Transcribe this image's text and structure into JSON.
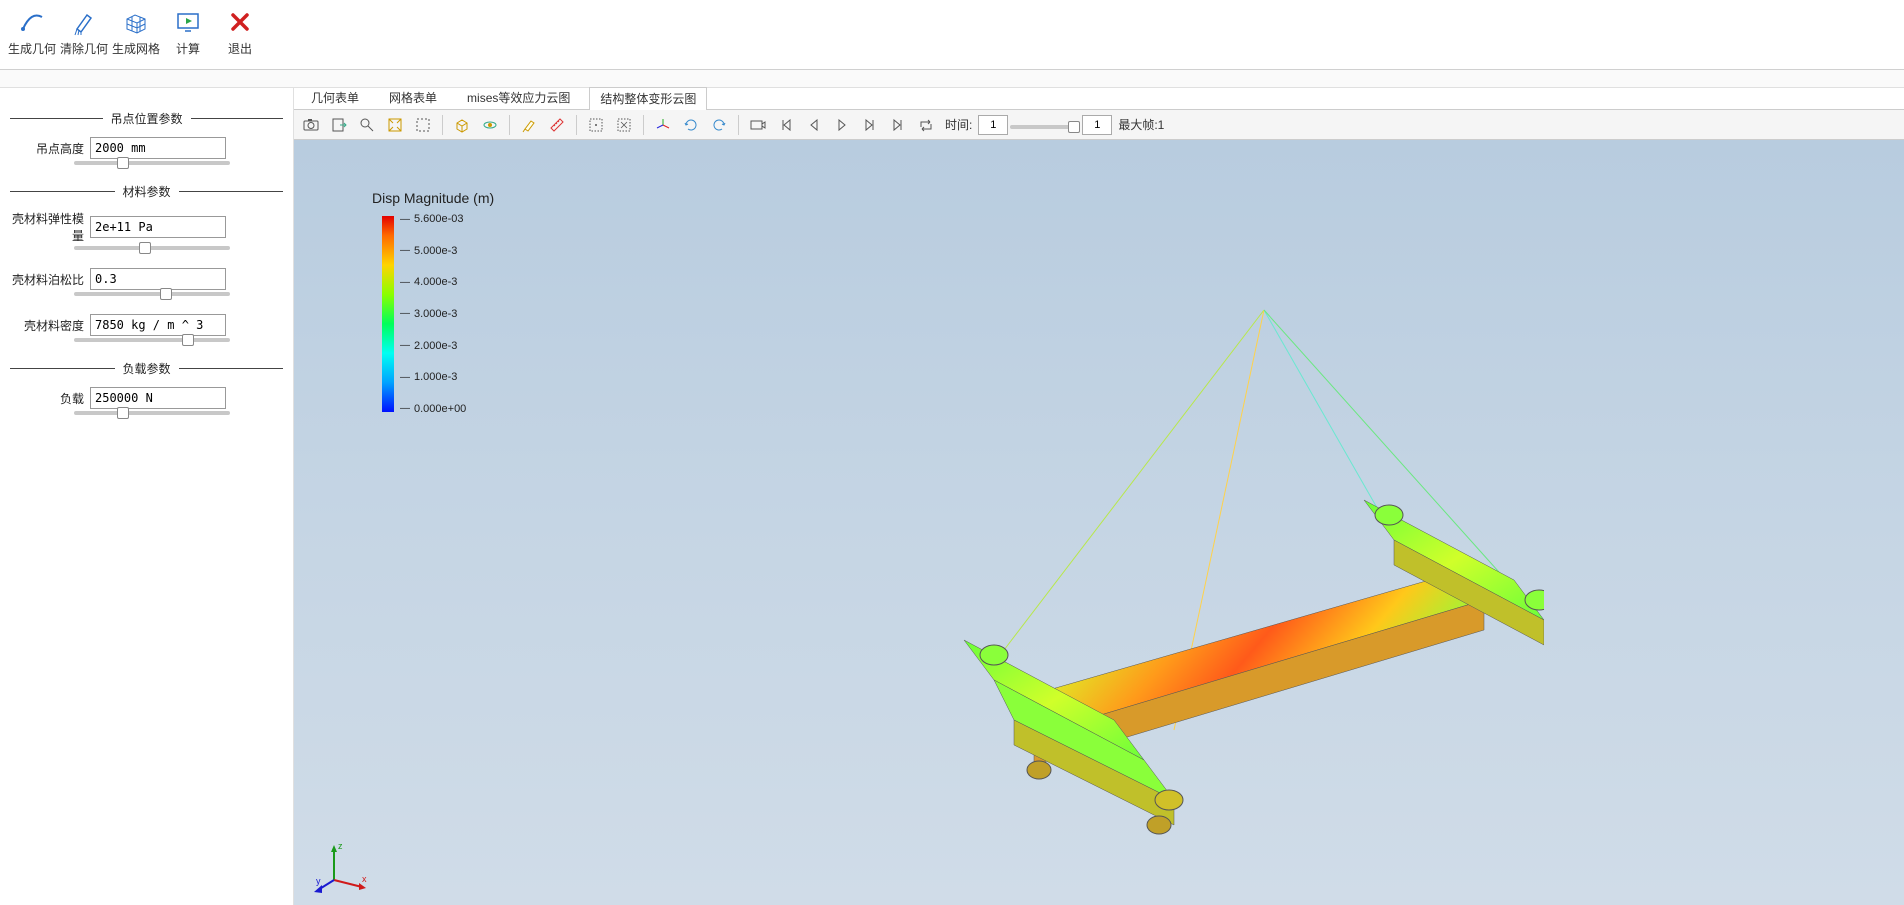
{
  "ribbon": {
    "generate_geometry": "生成几何",
    "clear_geometry": "清除几何",
    "generate_mesh": "生成网格",
    "compute": "计算",
    "exit": "退出"
  },
  "sidebar": {
    "section_position": "吊点位置参数",
    "section_material": "材料参数",
    "section_load": "负载参数",
    "params": {
      "lift_height_label": "吊点高度",
      "lift_height_value": "2000 mm",
      "elastic_modulus_label": "壳材料弹性模量",
      "elastic_modulus_value": "2e+11 Pa",
      "poisson_label": "壳材料泊松比",
      "poisson_value": "0.3",
      "density_label": "壳材料密度",
      "density_value": "7850 kg / m ^ 3",
      "load_label": "负载",
      "load_value": "250000 N"
    }
  },
  "tabs": {
    "geom_sheet": "几何表单",
    "mesh_sheet": "网格表单",
    "mises": "mises等效应力云图",
    "deform": "结构整体变形云图"
  },
  "toolbar": {
    "time_label": "时间:",
    "time_value": "1",
    "frame_value": "1",
    "max_frame_label": "最大帧:1"
  },
  "legend": {
    "title": "Disp Magnitude (m)",
    "ticks": [
      "5.600e-03",
      "5.000e-3",
      "4.000e-3",
      "3.000e-3",
      "2.000e-3",
      "1.000e-3",
      "0.000e+00"
    ]
  }
}
